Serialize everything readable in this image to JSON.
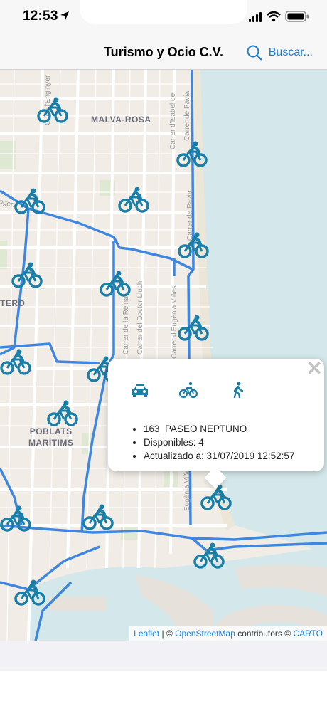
{
  "status_bar": {
    "time": "12:53"
  },
  "nav": {
    "title": "Turismo y Ocio C.V.",
    "search_label": "Buscar..."
  },
  "map": {
    "district_labels": {
      "malva_rosa": "MALVA-ROSA",
      "poblats_line1": "POBLATS",
      "poblats_line2": "MARÍTIMS",
      "tero": "TERO"
    },
    "street_labels": {
      "dingen": "C. de l'Enginyer",
      "isabel": "Carrer d'Isabel de",
      "pavia1": "Carrer de Pavia",
      "pavia2": "Carrer de Pavia",
      "reina": "Carrer de la Reina",
      "lluch": "Carrer del Doctor Lluch",
      "eugenia": "Carrer d'Eugènia Viñes",
      "eugenia2": "Eugènia Viñes",
      "rogers": "ogers"
    },
    "attribution": {
      "leaflet": "Leaflet",
      "sep1": " | © ",
      "osm": "OpenStreetMap",
      "contrib": " contributors © ",
      "carto": "CARTO"
    }
  },
  "popup": {
    "close": "✕",
    "modes": [
      "car-icon",
      "bike-icon",
      "walk-icon"
    ],
    "items": [
      "163_PASEO NEPTUNO",
      "Disponibles: 4",
      "Actualizado a: 31/07/2019 12:52:57"
    ]
  },
  "colors": {
    "accent": "#1a7fd4",
    "route": "#3f86e0",
    "marker": "#1a7fa8",
    "sea": "#d4e8ec",
    "land": "#f1ede6"
  }
}
